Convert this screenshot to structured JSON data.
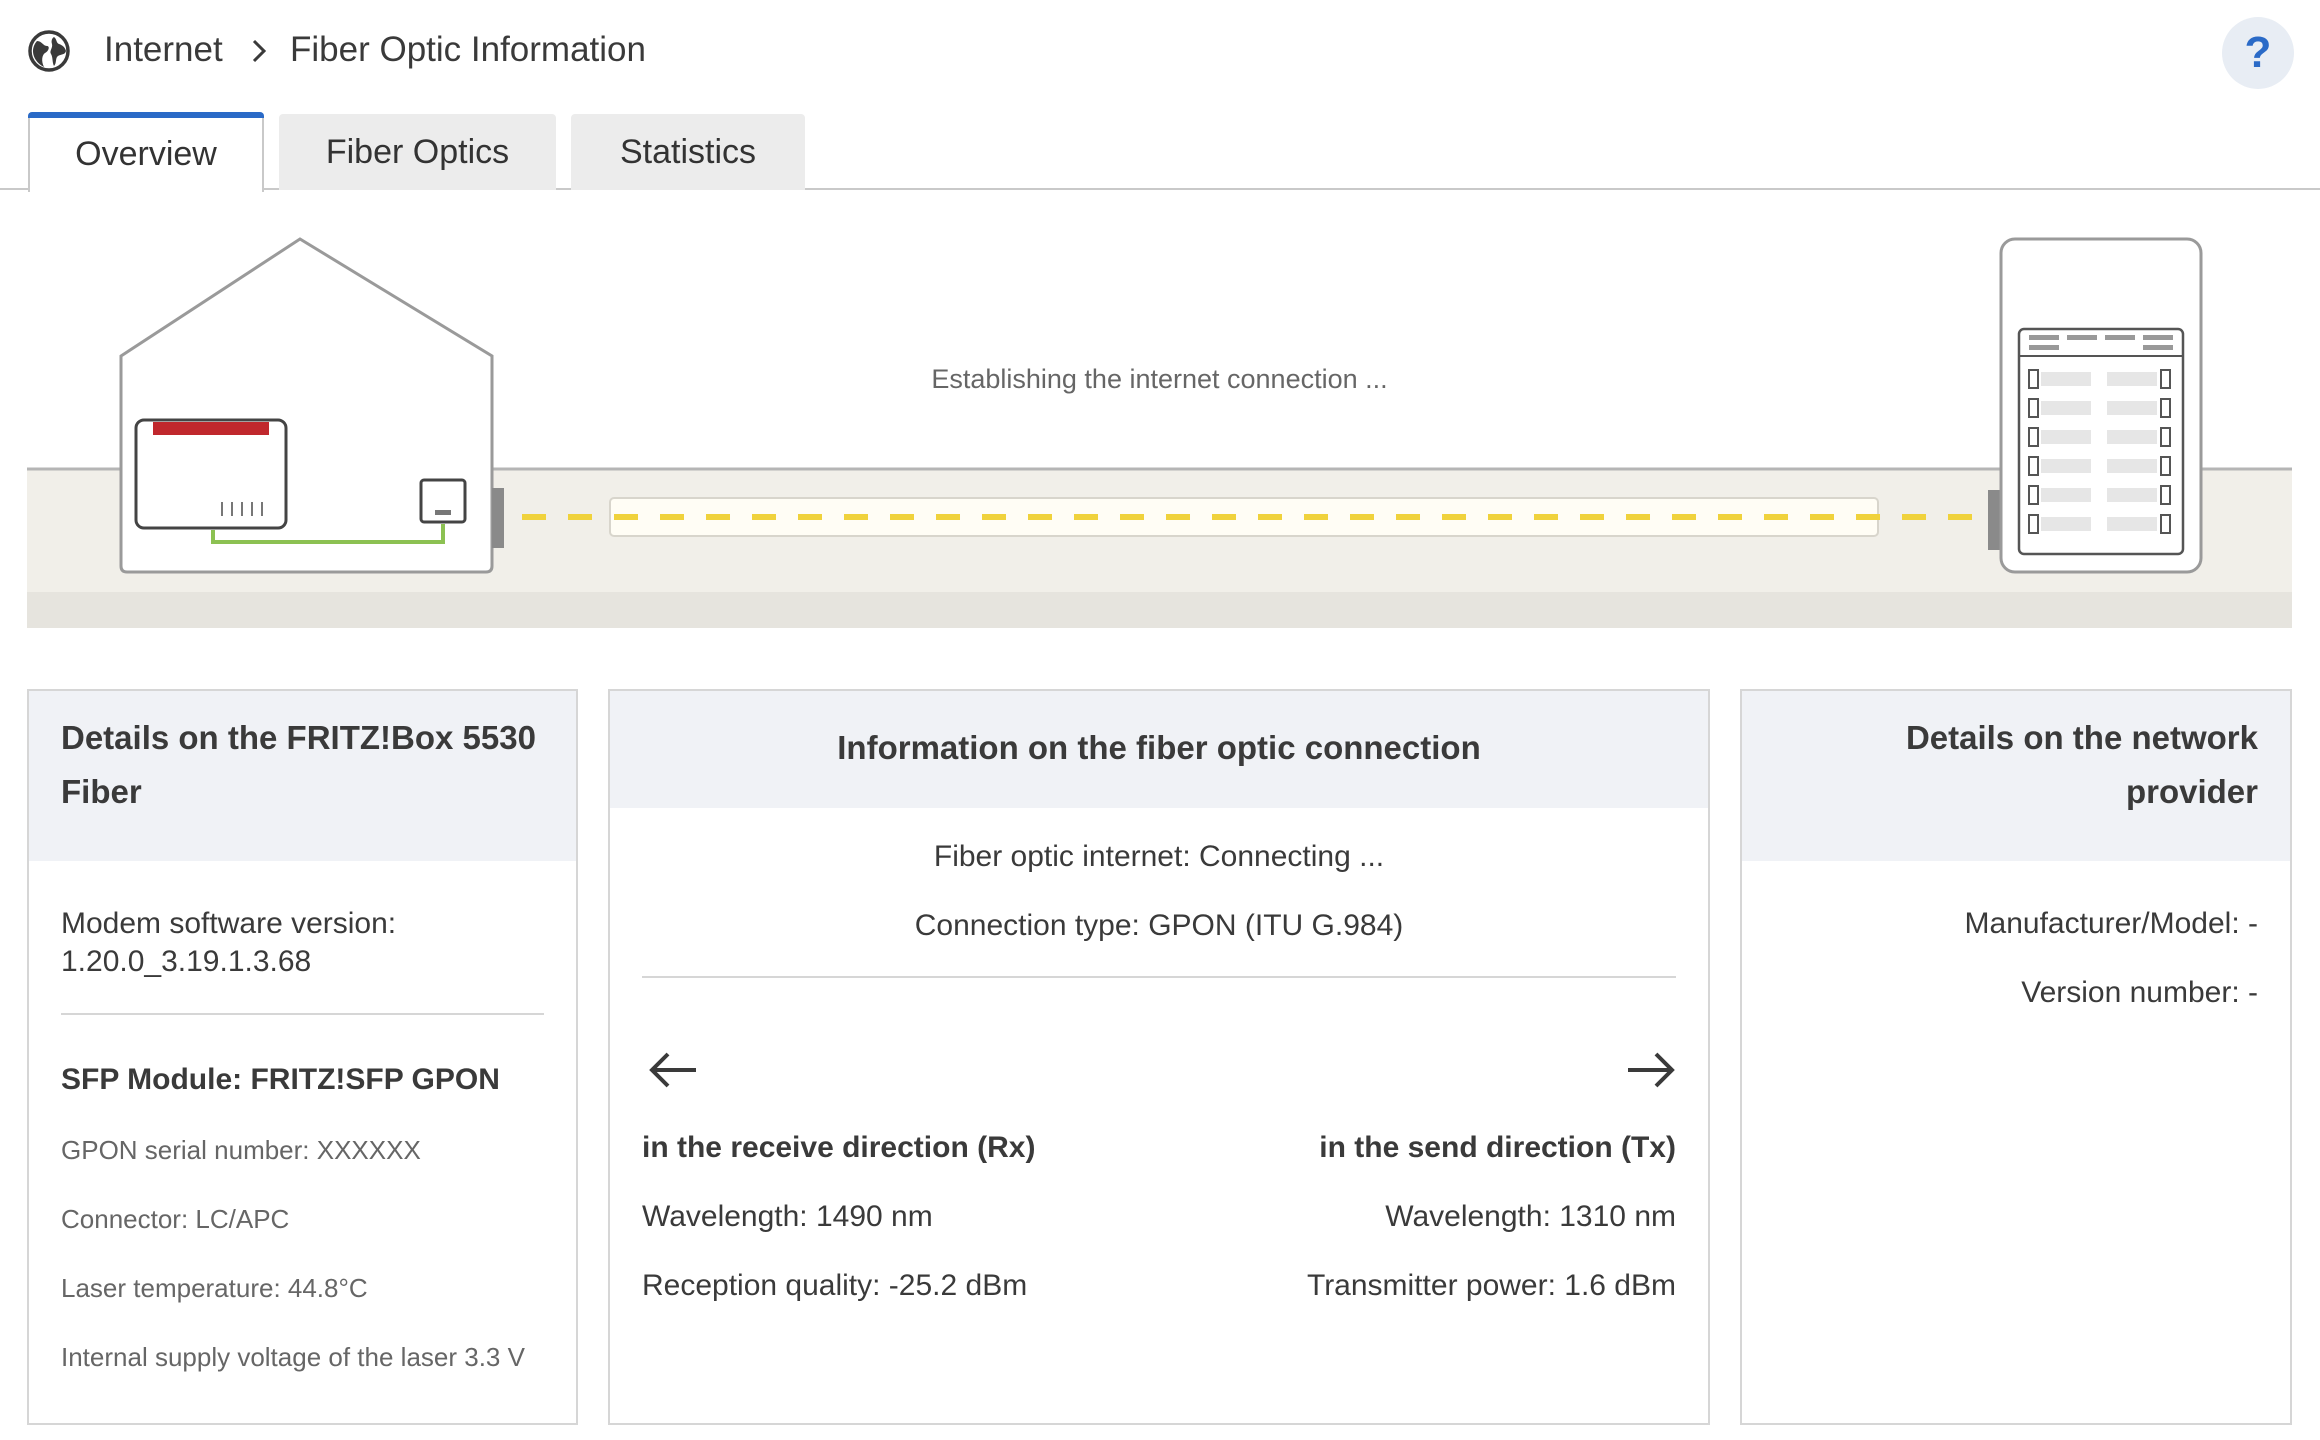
{
  "header": {
    "globe_icon": "globe-icon",
    "breadcrumb": [
      "Internet",
      "Fiber Optic Information"
    ],
    "help_label": "?"
  },
  "tabs": [
    {
      "label": "Overview",
      "active": true
    },
    {
      "label": "Fiber Optics",
      "active": false
    },
    {
      "label": "Statistics",
      "active": false
    }
  ],
  "illustration": {
    "status_text": "Establishing the internet connection ..."
  },
  "fritzbox_card": {
    "title": "Details on the FRITZ!Box 5530 Fiber",
    "modem_label": "Modem software version:",
    "modem_value": "1.20.0_3.19.1.3.68",
    "sfp_title": "SFP Module: FRITZ!SFP GPON",
    "gpon_serial": "GPON serial number: XXXXXX",
    "connector": "Connector: LC/APC",
    "laser_temp": "Laser temperature: 44.8°C",
    "supply_voltage": "Internal supply voltage of the laser 3.3 V"
  },
  "fiber_card": {
    "title": "Information on the fiber optic connection",
    "status": "Fiber optic internet: Connecting ...",
    "connection_type": "Connection type: GPON (ITU G.984)",
    "rx": {
      "title": "in the receive direction (Rx)",
      "wavelength": "Wavelength: 1490 nm",
      "quality": "Reception quality: -25.2 dBm"
    },
    "tx": {
      "title": "in the send direction (Tx)",
      "wavelength": "Wavelength: 1310 nm",
      "power": "Transmitter power: 1.6 dBm"
    }
  },
  "provider_card": {
    "title": "Details on the network provider",
    "manufacturer": "Manufacturer/Model: -",
    "version": "Version number: -"
  },
  "colors": {
    "accent": "#2a6ac7",
    "fiber_dash": "#f0d23c",
    "router_red": "#c0282d",
    "cable_green": "#8cc152"
  }
}
